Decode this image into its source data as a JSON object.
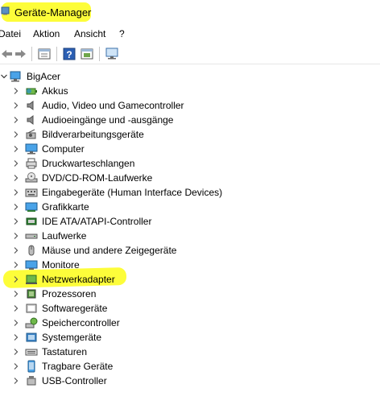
{
  "window": {
    "title": "Geräte-Manager"
  },
  "menu": [
    "Datei",
    "Aktion",
    "Ansicht",
    "?"
  ],
  "toolbar": {
    "buttons": [
      "back-arrow-icon",
      "forward-arrow-icon",
      "properties-icon",
      "help-icon",
      "driver-update-icon",
      "monitor-scan-icon"
    ]
  },
  "tree": {
    "root": "BigAcer",
    "categories": [
      {
        "label": "Akkus",
        "icon": "battery-icon"
      },
      {
        "label": "Audio, Video und Gamecontroller",
        "icon": "speaker-icon"
      },
      {
        "label": "Audioeingänge und -ausgänge",
        "icon": "speaker-icon"
      },
      {
        "label": "Bildverarbeitungsgeräte",
        "icon": "camera-icon"
      },
      {
        "label": "Computer",
        "icon": "computer-icon"
      },
      {
        "label": "Druckwarteschlangen",
        "icon": "printer-icon"
      },
      {
        "label": "DVD/CD-ROM-Laufwerke",
        "icon": "disc-drive-icon"
      },
      {
        "label": "Eingabegeräte (Human Interface Devices)",
        "icon": "hid-icon"
      },
      {
        "label": "Grafikkarte",
        "icon": "display-adapter-icon"
      },
      {
        "label": "IDE ATA/ATAPI-Controller",
        "icon": "ide-controller-icon"
      },
      {
        "label": "Laufwerke",
        "icon": "disk-drive-icon"
      },
      {
        "label": "Mäuse und andere Zeigegeräte",
        "icon": "mouse-icon"
      },
      {
        "label": "Monitore",
        "icon": "monitor-icon"
      },
      {
        "label": "Netzwerkadapter",
        "icon": "network-adapter-icon"
      },
      {
        "label": "Prozessoren",
        "icon": "processor-icon"
      },
      {
        "label": "Softwaregeräte",
        "icon": "software-device-icon"
      },
      {
        "label": "Speichercontroller",
        "icon": "storage-controller-icon"
      },
      {
        "label": "Systemgeräte",
        "icon": "system-device-icon"
      },
      {
        "label": "Tastaturen",
        "icon": "keyboard-icon"
      },
      {
        "label": "Tragbare Geräte",
        "icon": "portable-device-icon"
      },
      {
        "label": "USB-Controller",
        "icon": "usb-icon"
      }
    ]
  },
  "highlight_color": "#fdfd3a"
}
